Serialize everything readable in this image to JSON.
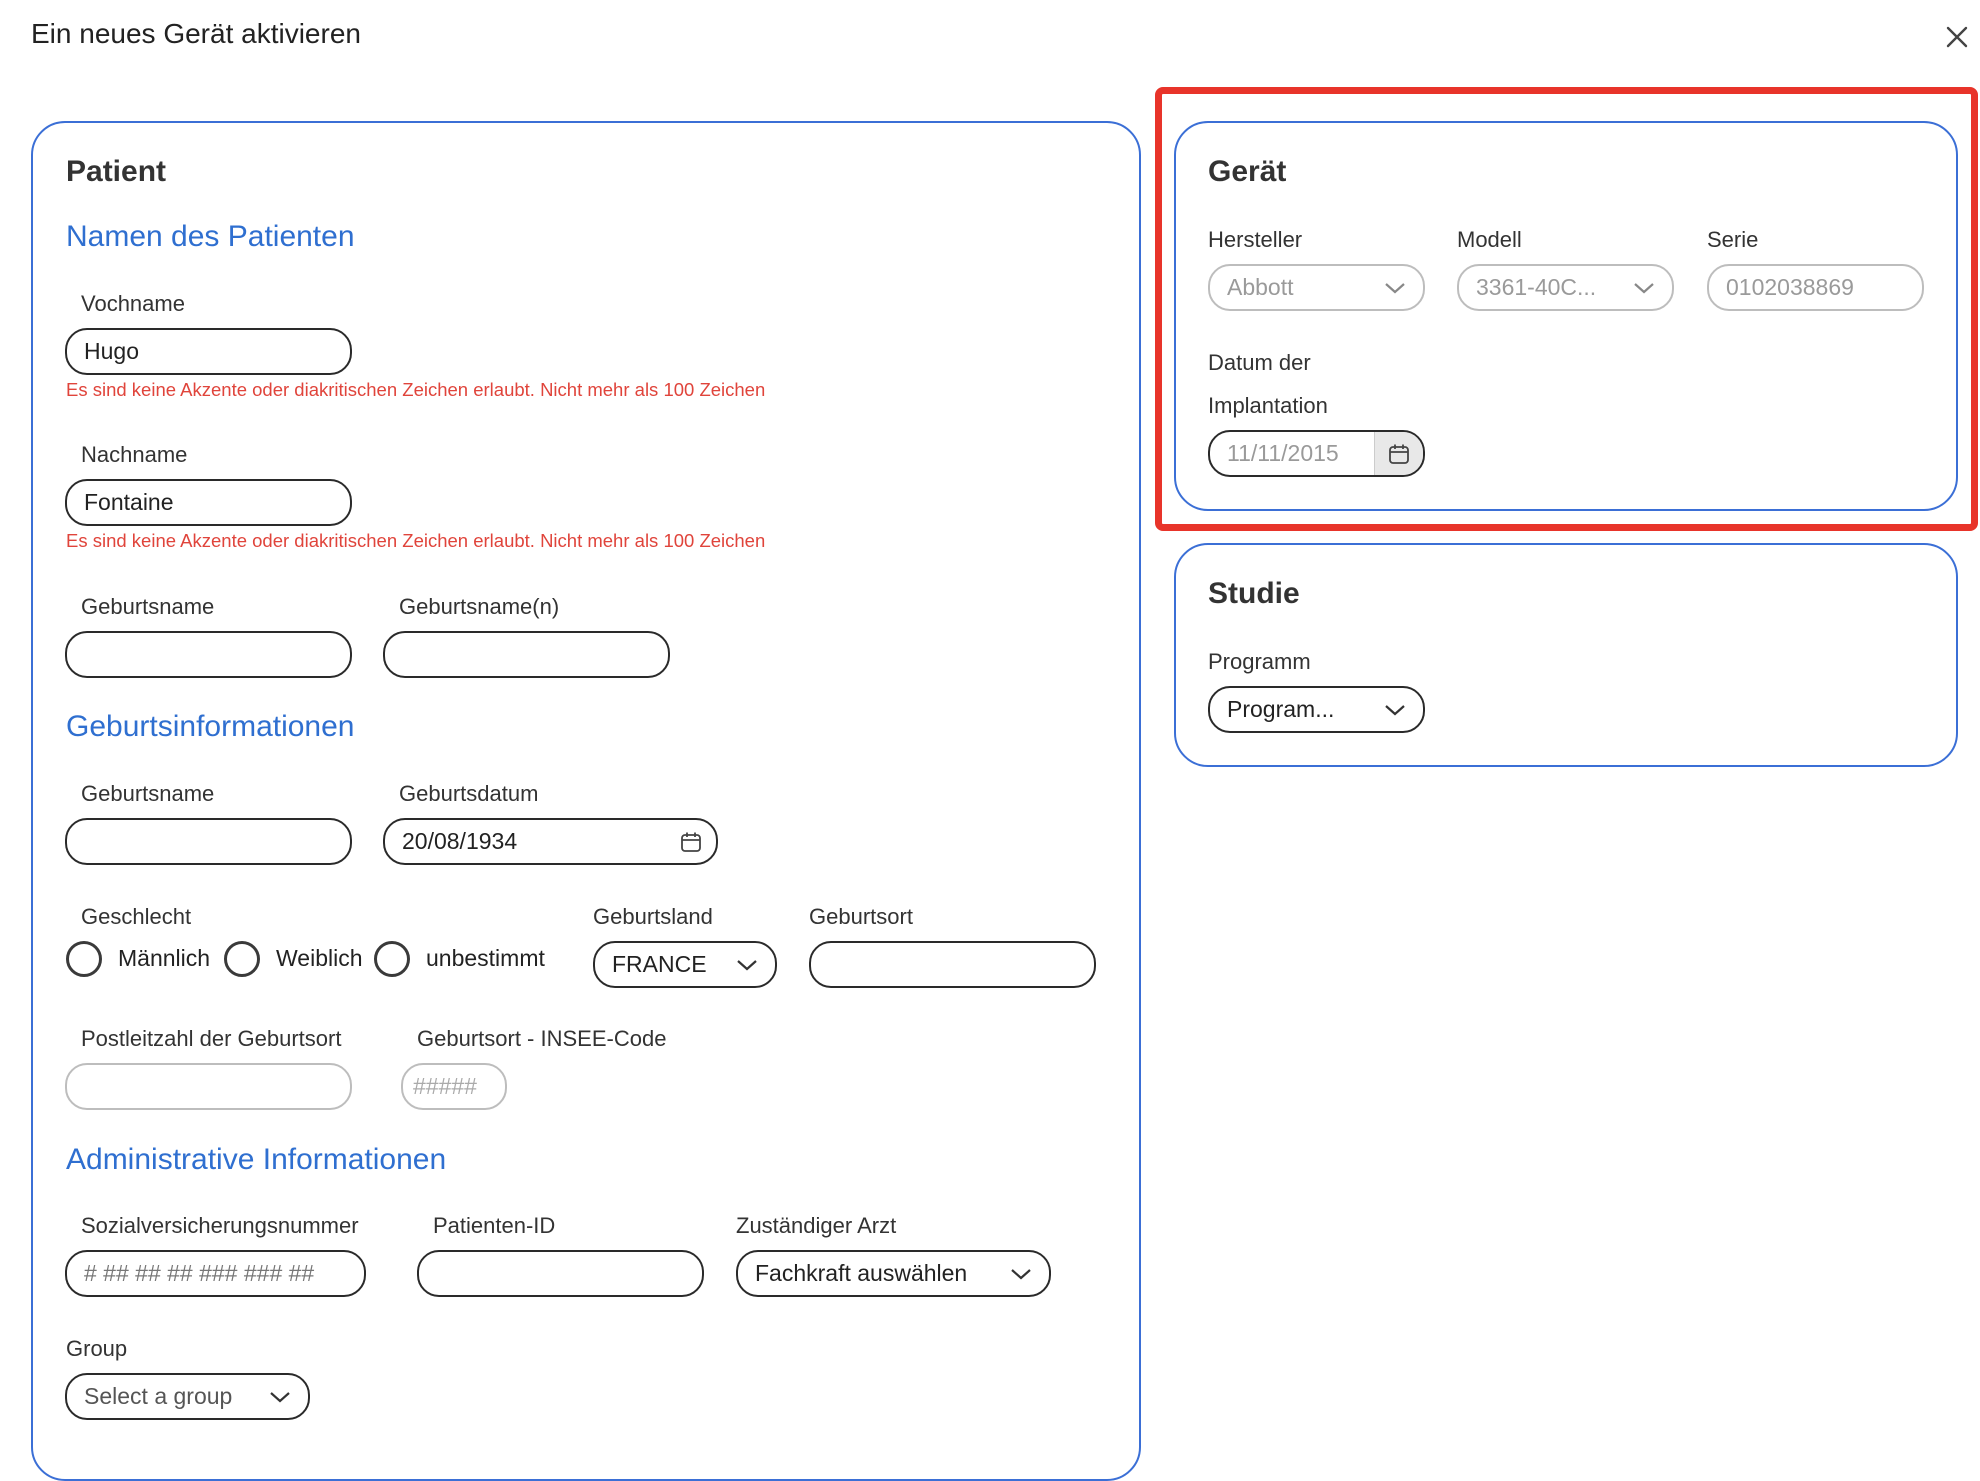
{
  "dialog": {
    "title": "Ein neues Gerät aktivieren"
  },
  "patient": {
    "title": "Patient",
    "names_section": "Namen des Patienten",
    "vorname_label": "Vochname",
    "vorname_value": "Hugo",
    "vorname_error": "Es sind keine Akzente oder diakritischen Zeichen erlaubt. Nicht mehr als 100 Zeichen",
    "nachname_label": "Nachname",
    "nachname_value": "Fontaine",
    "nachname_error": "Es sind keine Akzente oder diakritischen Zeichen erlaubt. Nicht mehr als 100 Zeichen",
    "geburtsname_label": "Geburtsname",
    "geburtsname_value": "",
    "geburtsnamen_label": "Geburtsname(n)",
    "geburtsnamen_value": "",
    "birth_section": "Geburtsinformationen",
    "birth_geburtsname_label": "Geburtsname",
    "birth_geburtsname_value": "",
    "geburtsdatum_label": "Geburtsdatum",
    "geburtsdatum_value": "20/08/1934",
    "geschlecht_label": "Geschlecht",
    "gender_options": [
      "Männlich",
      "Weiblich",
      "unbestimmt"
    ],
    "geburtsland_label": "Geburtsland",
    "geburtsland_value": "FRANCE",
    "geburtsort_label": "Geburtsort",
    "geburtsort_value": "",
    "plz_label": "Postleitzahl der Geburtsort",
    "plz_value": "",
    "insee_label": "Geburtsort - INSEE-Code",
    "insee_placeholder": "#####",
    "admin_section": "Administrative Informationen",
    "svn_label": "Sozialversicherungsnummer",
    "svn_placeholder": "# ## ## ## ### ### ##",
    "patient_id_label": "Patienten-ID",
    "patient_id_value": "",
    "arzt_label": "Zuständiger Arzt",
    "arzt_value": "Fachkraft auswählen",
    "group_label": "Group",
    "group_value": "Select a group"
  },
  "device": {
    "title": "Gerät",
    "hersteller_label": "Hersteller",
    "hersteller_value": "Abbott",
    "modell_label": "Modell",
    "modell_value": "3361-40C...",
    "serie_label": "Serie",
    "serie_value": "0102038869",
    "datum_label_line1": "Datum der",
    "datum_label_line2": "Implantation",
    "datum_value": "11/11/2015"
  },
  "study": {
    "title": "Studie",
    "programm_label": "Programm",
    "programm_value": "Program..."
  },
  "colors": {
    "accent_blue": "#2f6fd0",
    "card_border": "#3b6fd6",
    "error_red": "#e0443b",
    "highlight_red": "#e8342a"
  }
}
